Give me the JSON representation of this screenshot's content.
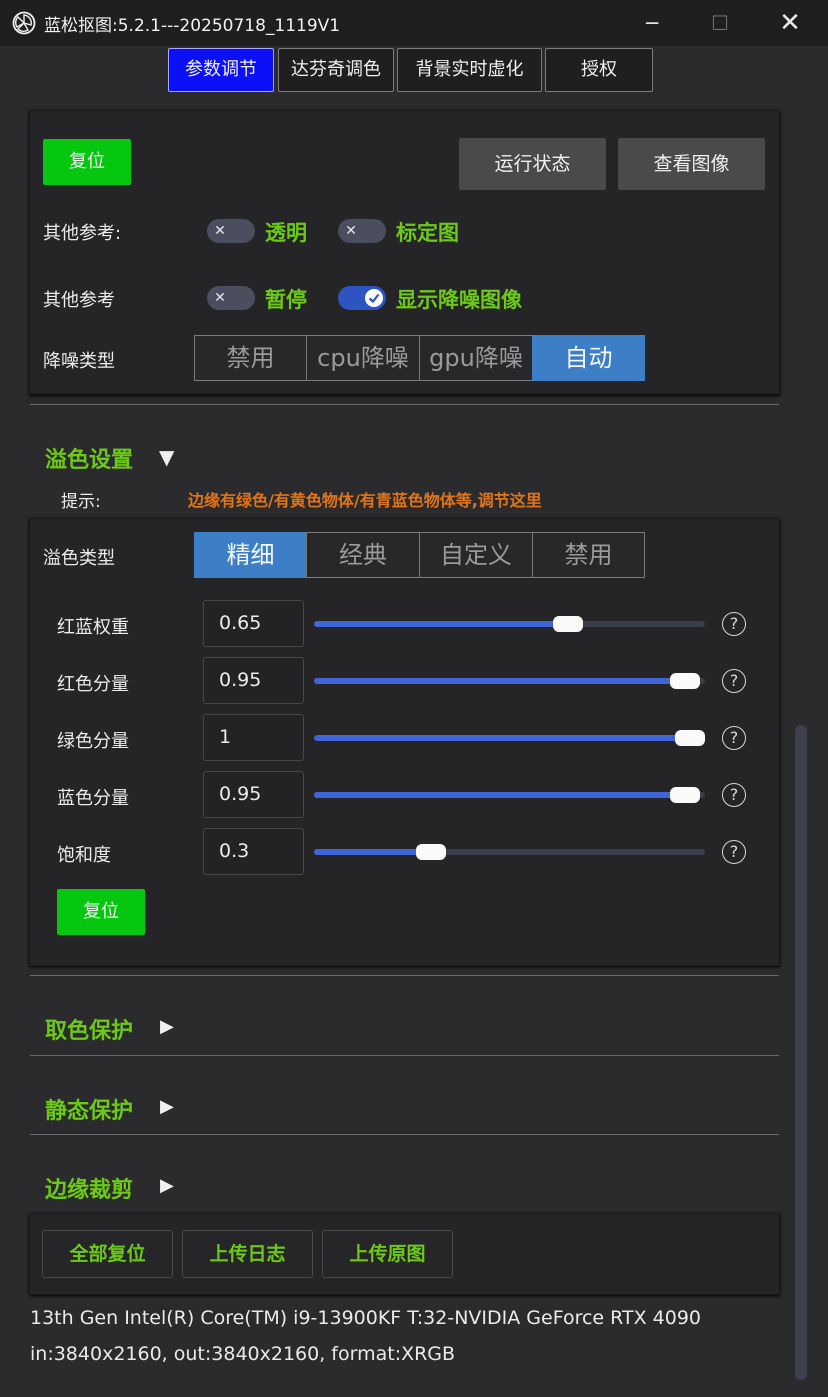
{
  "window": {
    "title": "蓝松抠图:5.2.1---20250718_1119V1",
    "min_glyph": "─",
    "max_glyph": "☐",
    "close_glyph": "✕"
  },
  "tabs": [
    {
      "label": "参数调节",
      "active": true
    },
    {
      "label": "达芬奇调色",
      "active": false
    },
    {
      "label": "背景实时虚化",
      "active": false
    },
    {
      "label": "授权",
      "active": false
    }
  ],
  "top_panel": {
    "reset_label": "复位",
    "run_state_label": "运行状态",
    "view_image_label": "查看图像",
    "row1": {
      "label": "其他参考:",
      "toggles": [
        {
          "label": "透明",
          "on": false
        },
        {
          "label": "标定图",
          "on": false
        }
      ]
    },
    "row2": {
      "label": "其他参考",
      "toggles": [
        {
          "label": "暂停",
          "on": false
        },
        {
          "label": "显示降噪图像",
          "on": true
        }
      ]
    },
    "denoise": {
      "label": "降噪类型",
      "options": [
        "禁用",
        "cpu降噪",
        "gpu降噪",
        "自动"
      ],
      "selected": "自动"
    }
  },
  "spill_section": {
    "title": "溢色设置",
    "arrow": "▼",
    "hint_label": "提示:",
    "hint_text": "边缘有绿色/有黄色物体/有青蓝色物体等,调节这里",
    "type_label": "溢色类型",
    "type_options": [
      "精细",
      "经典",
      "自定义",
      "禁用"
    ],
    "type_selected": "精细",
    "sliders": [
      {
        "label": "红蓝权重",
        "value": "0.65",
        "level": 0.65
      },
      {
        "label": "红色分量",
        "value": "0.95",
        "level": 0.95
      },
      {
        "label": "绿色分量",
        "value": "1",
        "level": 1.0
      },
      {
        "label": "蓝色分量",
        "value": "0.95",
        "level": 0.95
      },
      {
        "label": "饱和度",
        "value": "0.3",
        "level": 0.3
      }
    ],
    "help_glyph": "?",
    "reset_label": "复位"
  },
  "collapsed_sections": [
    {
      "title": "取色保护",
      "arrow": "▶"
    },
    {
      "title": "静态保护",
      "arrow": "▶"
    },
    {
      "title": "边缘裁剪",
      "arrow": "▶"
    }
  ],
  "bottom_buttons": {
    "reset_all": "全部复位",
    "upload_log": "上传日志",
    "upload_raw": "上传原图"
  },
  "info": {
    "line1": "13th Gen Intel(R) Core(TM) i9-13900KF T:32-NVIDIA GeForce RTX 4090",
    "line2": "in:3840x2160, out:3840x2160, format:XRGB"
  },
  "colors": {
    "accent_green": "#6cc919",
    "button_green": "#06c710",
    "active_tab": "#0b10f6",
    "selected_segment": "#3c7fc6",
    "slider_fill": "#3f65d6",
    "hint_orange": "#e0741a"
  }
}
